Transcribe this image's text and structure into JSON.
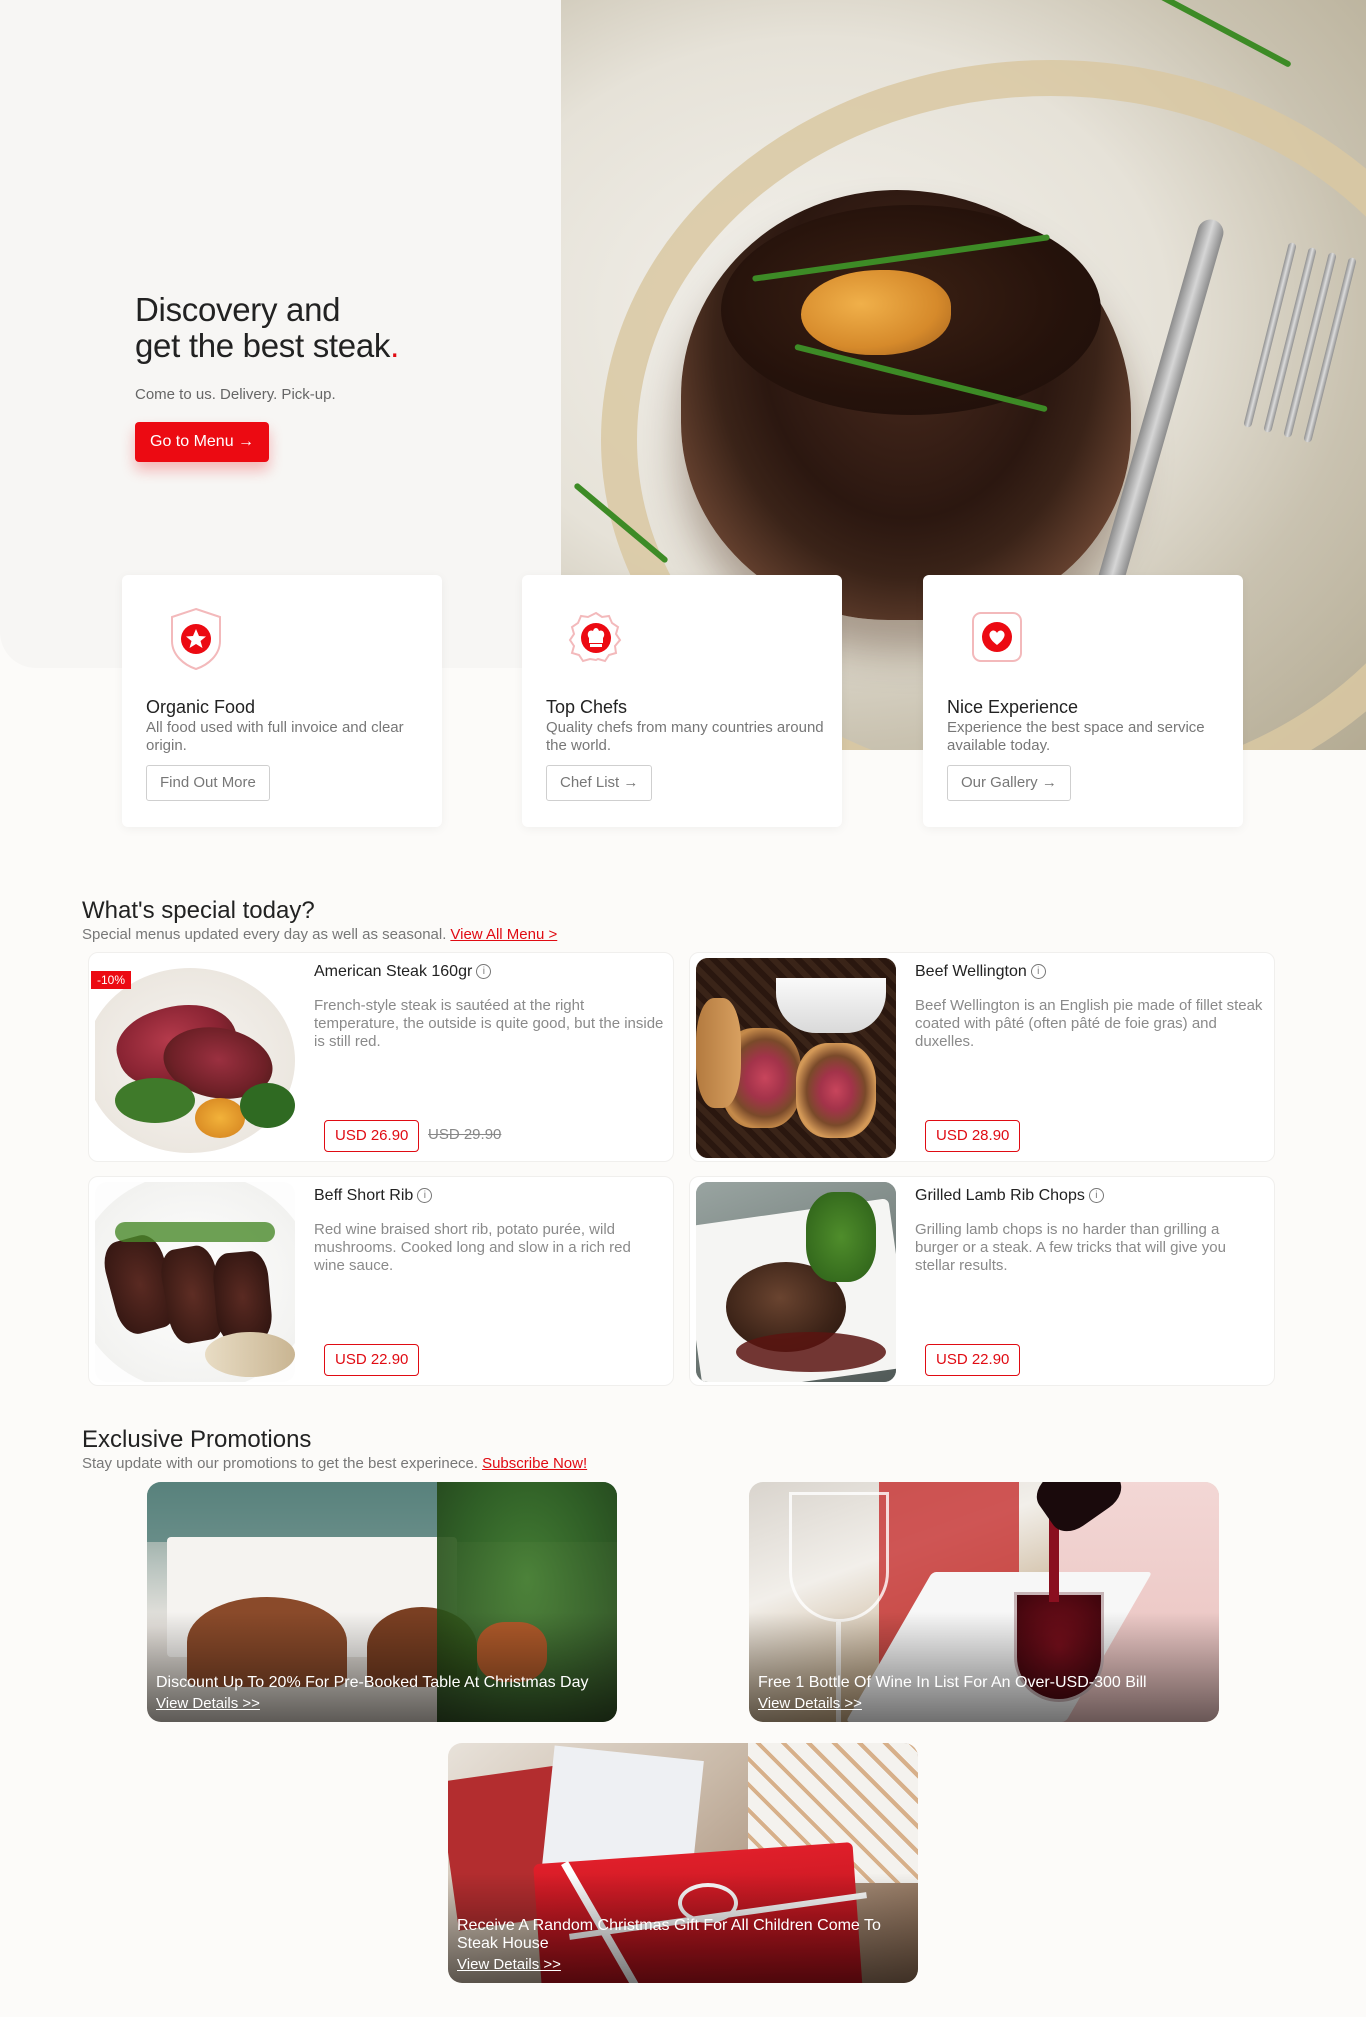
{
  "hero": {
    "title_line1": "Discovery and",
    "title_line2": "get the best steak",
    "title_dot": ".",
    "subtitle": "Come to us. Delivery. Pick-up.",
    "cta": "Go to Menu →"
  },
  "features": [
    {
      "title": "Organic Food",
      "text": "All food used with full invoice and clear origin.",
      "button": "Find Out More",
      "icon": "shield-star-icon"
    },
    {
      "title": "Top Chefs",
      "text": "Quality chefs from many countries around the world.",
      "button": "Chef List →",
      "icon": "chef-hat-badge-icon"
    },
    {
      "title": "Nice Experience",
      "text": "Experience the best space and service available today.",
      "button": "Our Gallery →",
      "icon": "heart-badge-icon"
    }
  ],
  "specials": {
    "title": "What's special today?",
    "subtitle": "Special menus updated every day as well as seasonal.",
    "link": "View All Menu >",
    "items": [
      {
        "name": "American Steak 160gr",
        "desc": "French-style steak is sautéed at the right temperature, the outside is quite good, but the inside is still red.",
        "price": "USD 26.90",
        "old_price": "USD 29.90",
        "discount": "-10%"
      },
      {
        "name": "Beef Wellington",
        "desc": "Beef Wellington is an English pie made of fillet steak coated with pâté (often pâté de foie gras) and duxelles.",
        "price": "USD 28.90"
      },
      {
        "name": "Beff Short Rib",
        "desc": "Red wine braised short rib, potato purée, wild mushrooms. Cooked long and slow in a rich red wine sauce.",
        "price": "USD 22.90"
      },
      {
        "name": "Grilled Lamb Rib Chops",
        "desc": "Grilling lamb chops is no harder than grilling a burger or a steak. A few tricks that will give you stellar results.",
        "price": "USD 22.90"
      }
    ]
  },
  "promotions": {
    "title": "Exclusive Promotions",
    "subtitle": "Stay update with our promotions to get the best experinece.",
    "link": "Subscribe Now!",
    "items": [
      {
        "title": "Discount Up To 20% For Pre-Booked Table At Christmas Day",
        "link": "View Details >>"
      },
      {
        "title": "Free 1 Bottle Of Wine In List For An Over-USD-300 Bill",
        "link": "View Details >>"
      },
      {
        "title": "Receive A Random Christmas Gift For All Children Come To Steak House",
        "link": "View Details >>"
      }
    ]
  },
  "colors": {
    "accent": "#ec0a12",
    "text": "#222222",
    "muted": "#777777"
  }
}
